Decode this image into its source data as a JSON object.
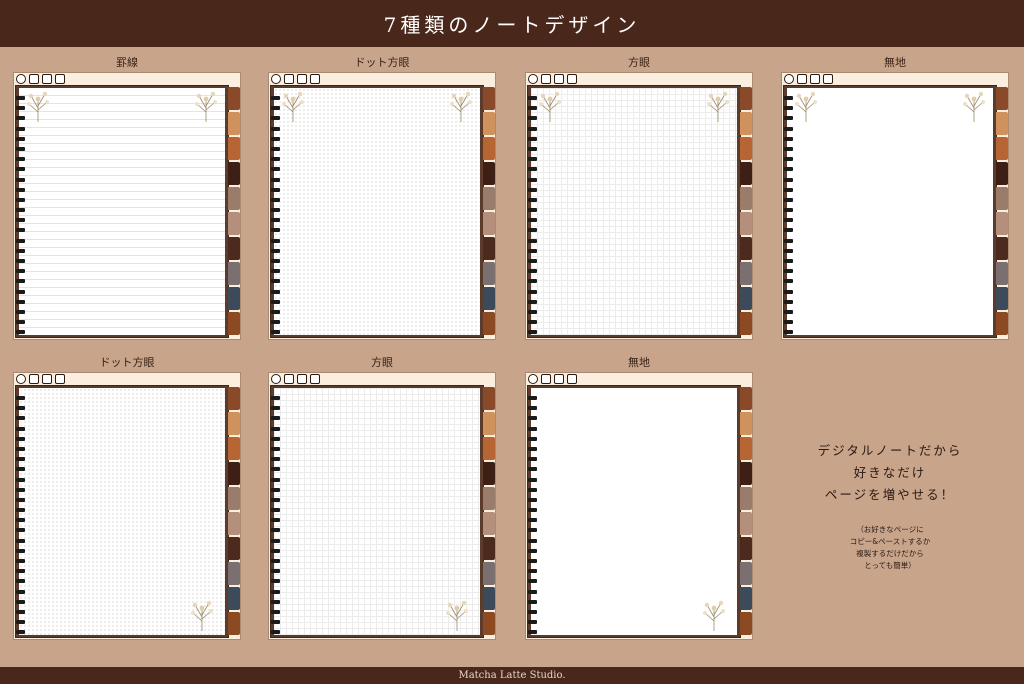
{
  "header": {
    "title": "7種類のノートデザイン"
  },
  "footer": {
    "text": "Matcha Latte Studio."
  },
  "notebooks": [
    {
      "label": "罫線",
      "style": "lined",
      "flowers": "top"
    },
    {
      "label": "ドット方眼",
      "style": "dot",
      "flowers": "top"
    },
    {
      "label": "方眼",
      "style": "grid",
      "flowers": "top"
    },
    {
      "label": "無地",
      "style": "plain",
      "flowers": "top"
    },
    {
      "label": "ドット方眼",
      "style": "dot",
      "flowers": "bottom"
    },
    {
      "label": "方眼",
      "style": "grid",
      "flowers": "bottom"
    },
    {
      "label": "無地",
      "style": "plain",
      "flowers": "bottom"
    }
  ],
  "tabs": [
    {
      "color": "#8a4a2a"
    },
    {
      "color": "#d0925c"
    },
    {
      "color": "#b76533"
    },
    {
      "color": "#3d1f16"
    },
    {
      "color": "#9a7c6a"
    },
    {
      "color": "#b48f7c"
    },
    {
      "color": "#4c2a1e"
    },
    {
      "color": "#7a7070"
    },
    {
      "color": "#3c4a5a"
    },
    {
      "color": "#8c4a22"
    }
  ],
  "toolbar_icons": [
    "home-icon",
    "notebook-icon",
    "calendar-icon",
    "mail-icon"
  ],
  "message": {
    "lines": [
      "デジタルノートだから",
      "好きなだけ",
      "ページを増やせる！"
    ],
    "note_lines": [
      "（お好きなページに",
      "コピー&ペーストするか",
      "複製するだけだから",
      "とっても簡単）"
    ]
  },
  "colors": {
    "header_bg": "#4a271b",
    "page_bg": "#c8a48a"
  }
}
